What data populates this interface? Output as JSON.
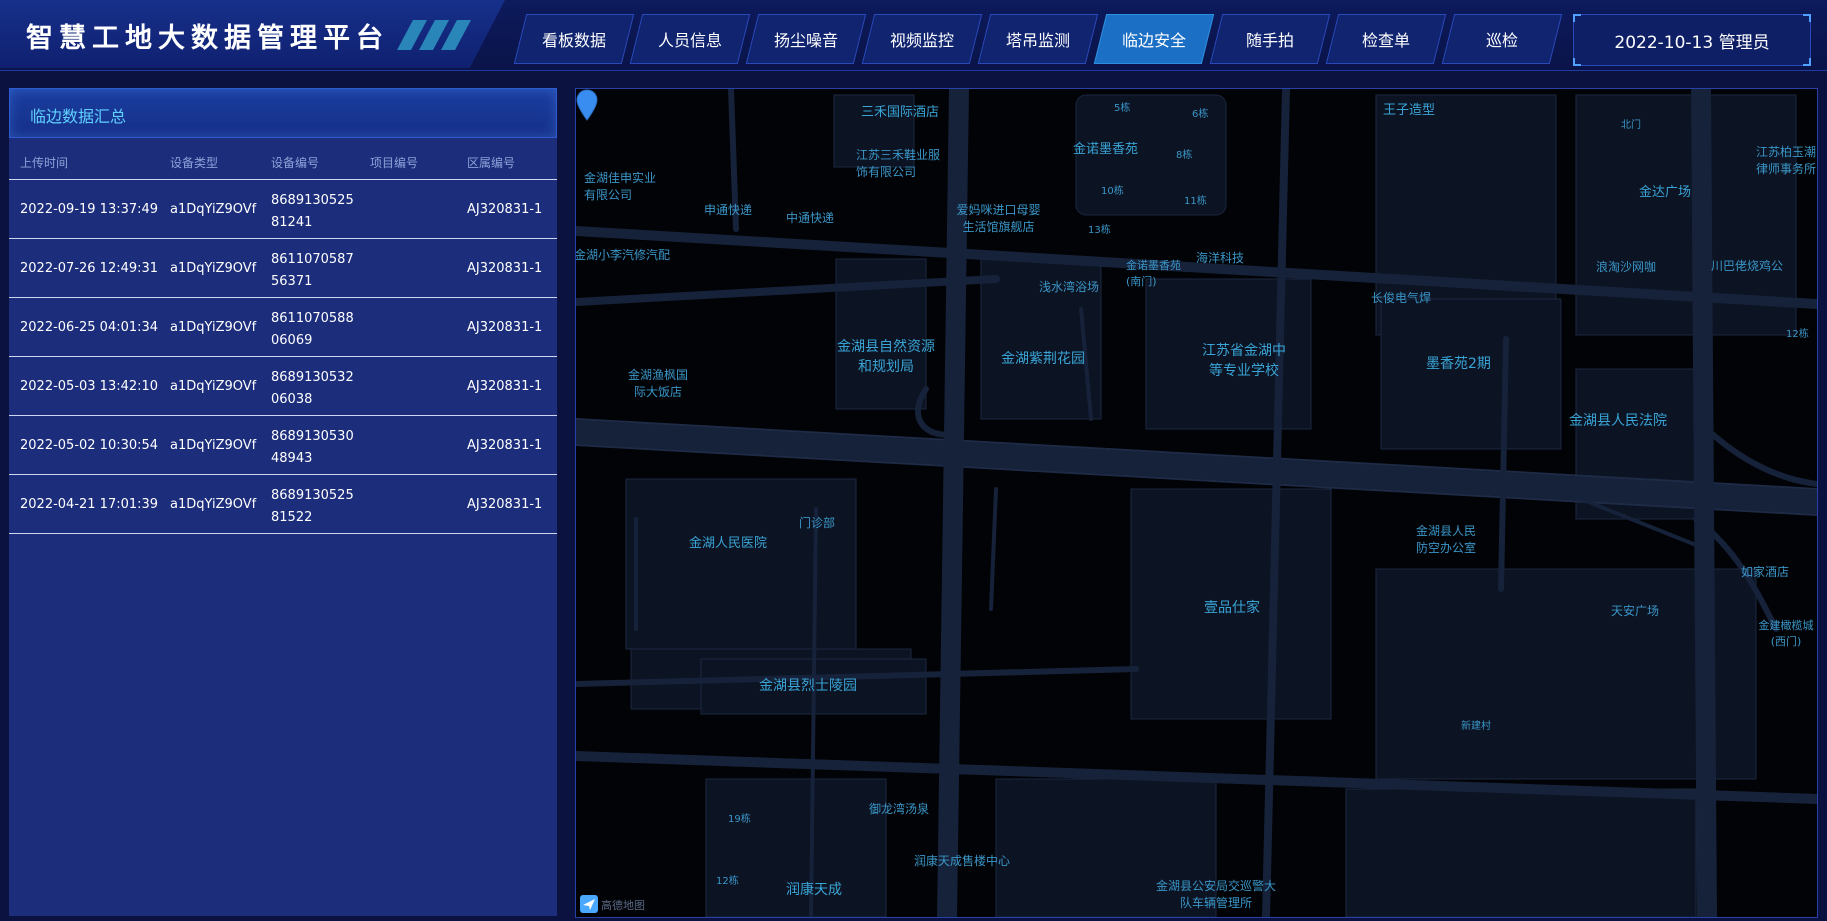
{
  "header": {
    "title": "智慧工地大数据管理平台",
    "date_user": "2022-10-13 管理员",
    "nav": [
      {
        "label": "看板数据",
        "active": false
      },
      {
        "label": "人员信息",
        "active": false
      },
      {
        "label": "扬尘噪音",
        "active": false
      },
      {
        "label": "视频监控",
        "active": false
      },
      {
        "label": "塔吊监测",
        "active": false
      },
      {
        "label": "临边安全",
        "active": true
      },
      {
        "label": "随手拍",
        "active": false
      },
      {
        "label": "检查单",
        "active": false
      },
      {
        "label": "巡检",
        "active": false
      }
    ]
  },
  "panel": {
    "title": "临边数据汇总",
    "columns": [
      "上传时间",
      "设备类型",
      "设备编号",
      "项目编号",
      "区属编号"
    ],
    "rows": [
      {
        "time": "2022-09-19 13:37:49",
        "type": "a1DqYiZ9OVf",
        "device": "868913052581241",
        "project": "",
        "area": "AJ320831-1"
      },
      {
        "time": "2022-07-26 12:49:31",
        "type": "a1DqYiZ9OVf",
        "device": "861107058756371",
        "project": "",
        "area": "AJ320831-1"
      },
      {
        "time": "2022-06-25 04:01:34",
        "type": "a1DqYiZ9OVf",
        "device": "861107058806069",
        "project": "",
        "area": "AJ320831-1"
      },
      {
        "time": "2022-05-03 13:42:10",
        "type": "a1DqYiZ9OVf",
        "device": "868913053206038",
        "project": "",
        "area": "AJ320831-1"
      },
      {
        "time": "2022-05-02 10:30:54",
        "type": "a1DqYiZ9OVf",
        "device": "868913053048943",
        "project": "",
        "area": "AJ320831-1"
      },
      {
        "time": "2022-04-21 17:01:39",
        "type": "a1DqYiZ9OVf",
        "device": "868913052581522",
        "project": "",
        "area": "AJ320831-1"
      }
    ]
  },
  "map": {
    "logo_text": "高德地图",
    "labels": {
      "l01": "三禾国际酒店",
      "l02": "5栋",
      "l03": "6栋",
      "l04": "王子造型",
      "l05": "北门",
      "l06": "江苏柏玉潮律师事务所",
      "l07": "江苏三禾鞋业服饰有限公司",
      "l08": "金诺墨香苑",
      "l09": "8栋",
      "l10": "金湖佳申实业有限公司",
      "l11": "10栋",
      "l12": "11栋",
      "l13": "金达广场",
      "l14": "申通快递",
      "l15": "中通快递",
      "l16": "爱妈咪进口母婴生活馆旗舰店",
      "l17": "13栋",
      "l18": "金湖小李汽修汽配",
      "l19": "海洋科技",
      "l20": "金诺墨香苑(南门)",
      "l21": "浅水湾浴场",
      "l22": "长俊电气焊",
      "l23": "浪淘沙网咖",
      "l24": "川巴佬烧鸡公",
      "l25": "金湖县自然资源和规划局",
      "l26": "金湖紫荆花园",
      "l27": "江苏省金湖中等专业学校",
      "l28": "墨香苑2期",
      "l29": "12栋",
      "l30": "金湖渔枫国际大饭店",
      "l31": "金湖县人民法院",
      "l32": "门诊部",
      "l33": "金湖人民医院",
      "l34": "金湖县人民防空办公室",
      "l35": "如家酒店",
      "l36": "壹品仕家",
      "l37": "天安广场",
      "l38": "金建橄榄城(西门)",
      "l39": "金湖县烈士陵园",
      "l40": "新建村",
      "l41": "御龙湾汤泉",
      "l42": "19栋",
      "l43": "润康天成售楼中心",
      "l44": "12栋",
      "l45": "润康天成",
      "l46": "金湖县公安局交巡警大队车辆管理所"
    }
  }
}
